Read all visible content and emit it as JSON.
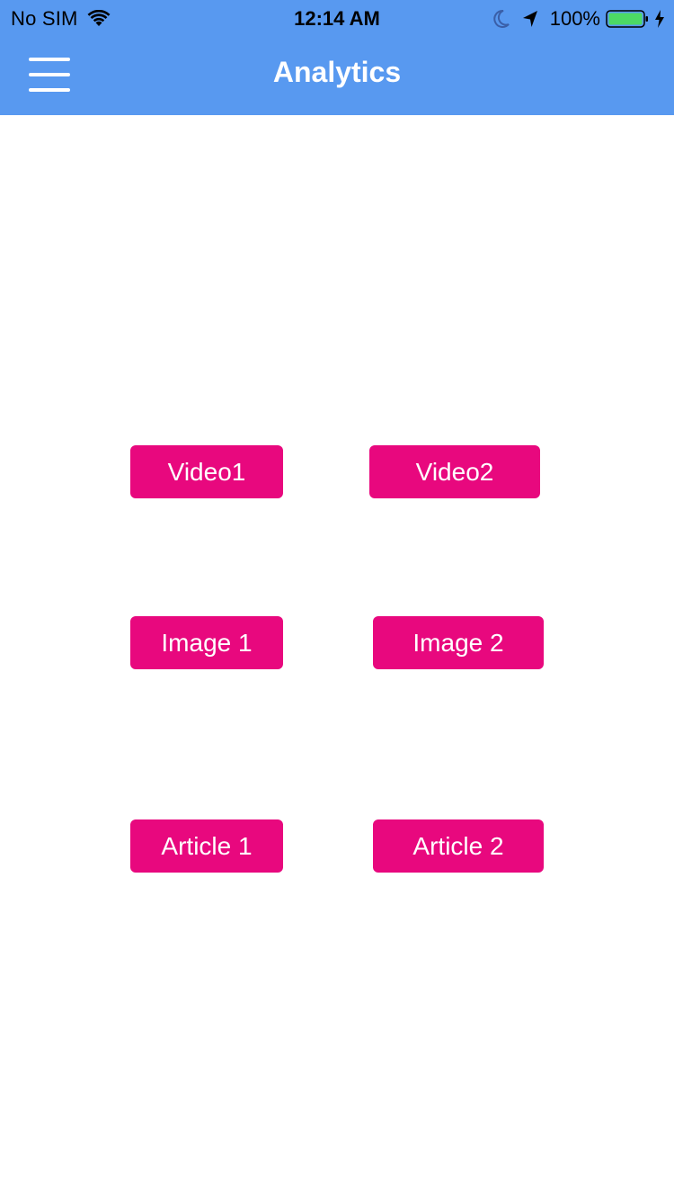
{
  "status_bar": {
    "carrier": "No SIM",
    "time": "12:14 AM",
    "battery_percent": "100%",
    "icons": [
      "wifi-icon",
      "moon-icon",
      "location-arrow-icon",
      "battery-icon",
      "charging-bolt-icon"
    ]
  },
  "nav": {
    "title": "Analytics",
    "menu_icon": "hamburger-menu-icon"
  },
  "buttons": {
    "video1": "Video1",
    "video2": "Video2",
    "image1": "Image 1",
    "image2": "Image 2",
    "article1": "Article 1",
    "article2": "Article 2"
  },
  "colors": {
    "header_bg": "#5899f0",
    "button_bg": "#e8087e",
    "button_text": "#ffffff",
    "battery_fill": "#4cd964"
  }
}
